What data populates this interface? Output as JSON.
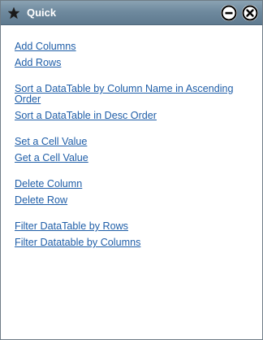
{
  "window": {
    "title": "Quick",
    "title_icon": "star-icon",
    "minimize_icon": "minus-circle-icon",
    "close_icon": "x-circle-icon"
  },
  "links": {
    "group1": [
      "Add Columns",
      "Add Rows"
    ],
    "group2": [
      "Sort a DataTable by Column Name in Ascending Order",
      "Sort a DataTable in Desc Order"
    ],
    "group3": [
      "Set a Cell Value",
      "Get a Cell Value"
    ],
    "group4": [
      "Delete Column",
      "Delete Row"
    ],
    "group5": [
      "Filter DataTable by Rows",
      "Filter Datatable by Columns"
    ]
  },
  "colors": {
    "titlebar": "#6f8a9e",
    "link": "#1f5ea8",
    "background": "#ffffff"
  }
}
